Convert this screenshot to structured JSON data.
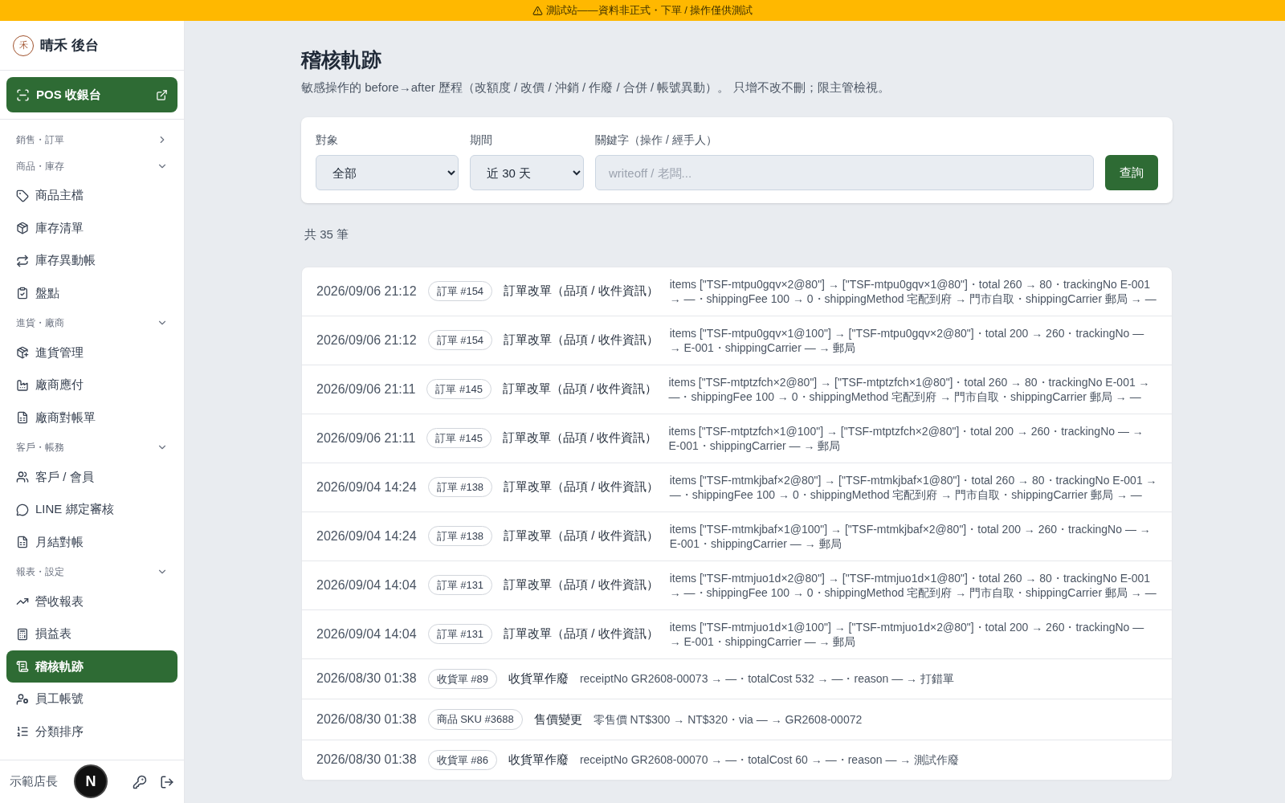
{
  "banner": {
    "text": "測試站——資料非正式・下單 / 操作僅供測試"
  },
  "sidebar": {
    "logo_mark": "禾",
    "brand": "晴禾 後台",
    "pos_button": "POS 收銀台",
    "sections": [
      {
        "label": "銷售・訂單",
        "expanded": false
      },
      {
        "label": "商品・庫存",
        "expanded": true,
        "items": [
          {
            "label": "商品主檔",
            "selected": false
          },
          {
            "label": "庫存清單",
            "selected": false
          },
          {
            "label": "庫存異動帳",
            "selected": false
          },
          {
            "label": "盤點",
            "selected": false
          }
        ]
      },
      {
        "label": "進貨・廠商",
        "expanded": true,
        "items": [
          {
            "label": "進貨管理",
            "selected": false
          },
          {
            "label": "廠商應付",
            "selected": false
          },
          {
            "label": "廠商對帳單",
            "selected": false
          }
        ]
      },
      {
        "label": "客戶・帳務",
        "expanded": true,
        "items": [
          {
            "label": "客戶 / 會員",
            "selected": false
          },
          {
            "label": "LINE 綁定審核",
            "selected": false
          },
          {
            "label": "月結對帳",
            "selected": false
          }
        ]
      },
      {
        "label": "報表・設定",
        "expanded": true,
        "items": [
          {
            "label": "營收報表",
            "selected": false
          },
          {
            "label": "損益表",
            "selected": false
          },
          {
            "label": "稽核軌跡",
            "selected": true
          },
          {
            "label": "員工帳號",
            "selected": false
          },
          {
            "label": "分類排序",
            "selected": false
          }
        ]
      }
    ],
    "user": "示範店長",
    "dev_badge": "N"
  },
  "page": {
    "title": "稽核軌跡",
    "subtitle": "敏感操作的 before→after 歷程（改額度 / 改價 / 沖銷 / 作廢 / 合併 / 帳號異動）。 只增不改不刪；限主管檢視。"
  },
  "filters": {
    "target_label": "對象",
    "target_value": "全部",
    "period_label": "期間",
    "period_value": "近 30 天",
    "keyword_label": "關鍵字（操作 / 經手人）",
    "keyword_placeholder": "writeoff / 老闆...",
    "search_button": "查詢"
  },
  "count": "共 35 筆",
  "rows": [
    {
      "time": "2026/09/06 21:12",
      "ref": "訂單 #154",
      "action": "訂單改單（品項 / 收件資訊）",
      "detail": "items [\"TSF-mtpu0gqv×2@80\"] → [\"TSF-mtpu0gqv×1@80\"]・total 260 → 80・trackingNo E-001 → —・shippingFee 100 → 0・shippingMethod 宅配到府 → 門市自取・shippingCarrier 郵局 → —"
    },
    {
      "time": "2026/09/06 21:12",
      "ref": "訂單 #154",
      "action": "訂單改單（品項 / 收件資訊）",
      "detail": "items [\"TSF-mtpu0gqv×1@100\"] → [\"TSF-mtpu0gqv×2@80\"]・total 200 → 260・trackingNo — → E-001・shippingCarrier — → 郵局"
    },
    {
      "time": "2026/09/06 21:11",
      "ref": "訂單 #145",
      "action": "訂單改單（品項 / 收件資訊）",
      "detail": "items [\"TSF-mtptzfch×2@80\"] → [\"TSF-mtptzfch×1@80\"]・total 260 → 80・trackingNo E-001 → —・shippingFee 100 → 0・shippingMethod 宅配到府 → 門市自取・shippingCarrier 郵局 → —"
    },
    {
      "time": "2026/09/06 21:11",
      "ref": "訂單 #145",
      "action": "訂單改單（品項 / 收件資訊）",
      "detail": "items [\"TSF-mtptzfch×1@100\"] → [\"TSF-mtptzfch×2@80\"]・total 200 → 260・trackingNo — → E-001・shippingCarrier — → 郵局"
    },
    {
      "time": "2026/09/04 14:24",
      "ref": "訂單 #138",
      "action": "訂單改單（品項 / 收件資訊）",
      "detail": "items [\"TSF-mtmkjbaf×2@80\"] → [\"TSF-mtmkjbaf×1@80\"]・total 260 → 80・trackingNo E-001 → —・shippingFee 100 → 0・shippingMethod 宅配到府 → 門市自取・shippingCarrier 郵局 → —"
    },
    {
      "time": "2026/09/04 14:24",
      "ref": "訂單 #138",
      "action": "訂單改單（品項 / 收件資訊）",
      "detail": "items [\"TSF-mtmkjbaf×1@100\"] → [\"TSF-mtmkjbaf×2@80\"]・total 200 → 260・trackingNo — → E-001・shippingCarrier — → 郵局"
    },
    {
      "time": "2026/09/04 14:04",
      "ref": "訂單 #131",
      "action": "訂單改單（品項 / 收件資訊）",
      "detail": "items [\"TSF-mtmjuo1d×2@80\"] → [\"TSF-mtmjuo1d×1@80\"]・total 260 → 80・trackingNo E-001 → —・shippingFee 100 → 0・shippingMethod 宅配到府 → 門市自取・shippingCarrier 郵局 → —"
    },
    {
      "time": "2026/09/04 14:04",
      "ref": "訂單 #131",
      "action": "訂單改單（品項 / 收件資訊）",
      "detail": "items [\"TSF-mtmjuo1d×1@100\"] → [\"TSF-mtmjuo1d×2@80\"]・total 200 → 260・trackingNo — → E-001・shippingCarrier — → 郵局"
    },
    {
      "time": "2026/08/30 01:38",
      "ref": "收貨單 #89",
      "action": "收貨單作廢",
      "detail": "receiptNo GR2608-00073 → —・totalCost 532 → —・reason — → 打錯單"
    },
    {
      "time": "2026/08/30 01:38",
      "ref": "商品 SKU #3688",
      "action": "售價變更",
      "detail": "零售價 NT$300 → NT$320・via — → GR2608-00072"
    },
    {
      "time": "2026/08/30 01:38",
      "ref": "收貨單 #86",
      "action": "收貨單作廢",
      "detail": "receiptNo GR2608-00070 → —・totalCost 60 → —・reason — → 測試作廢"
    }
  ]
}
